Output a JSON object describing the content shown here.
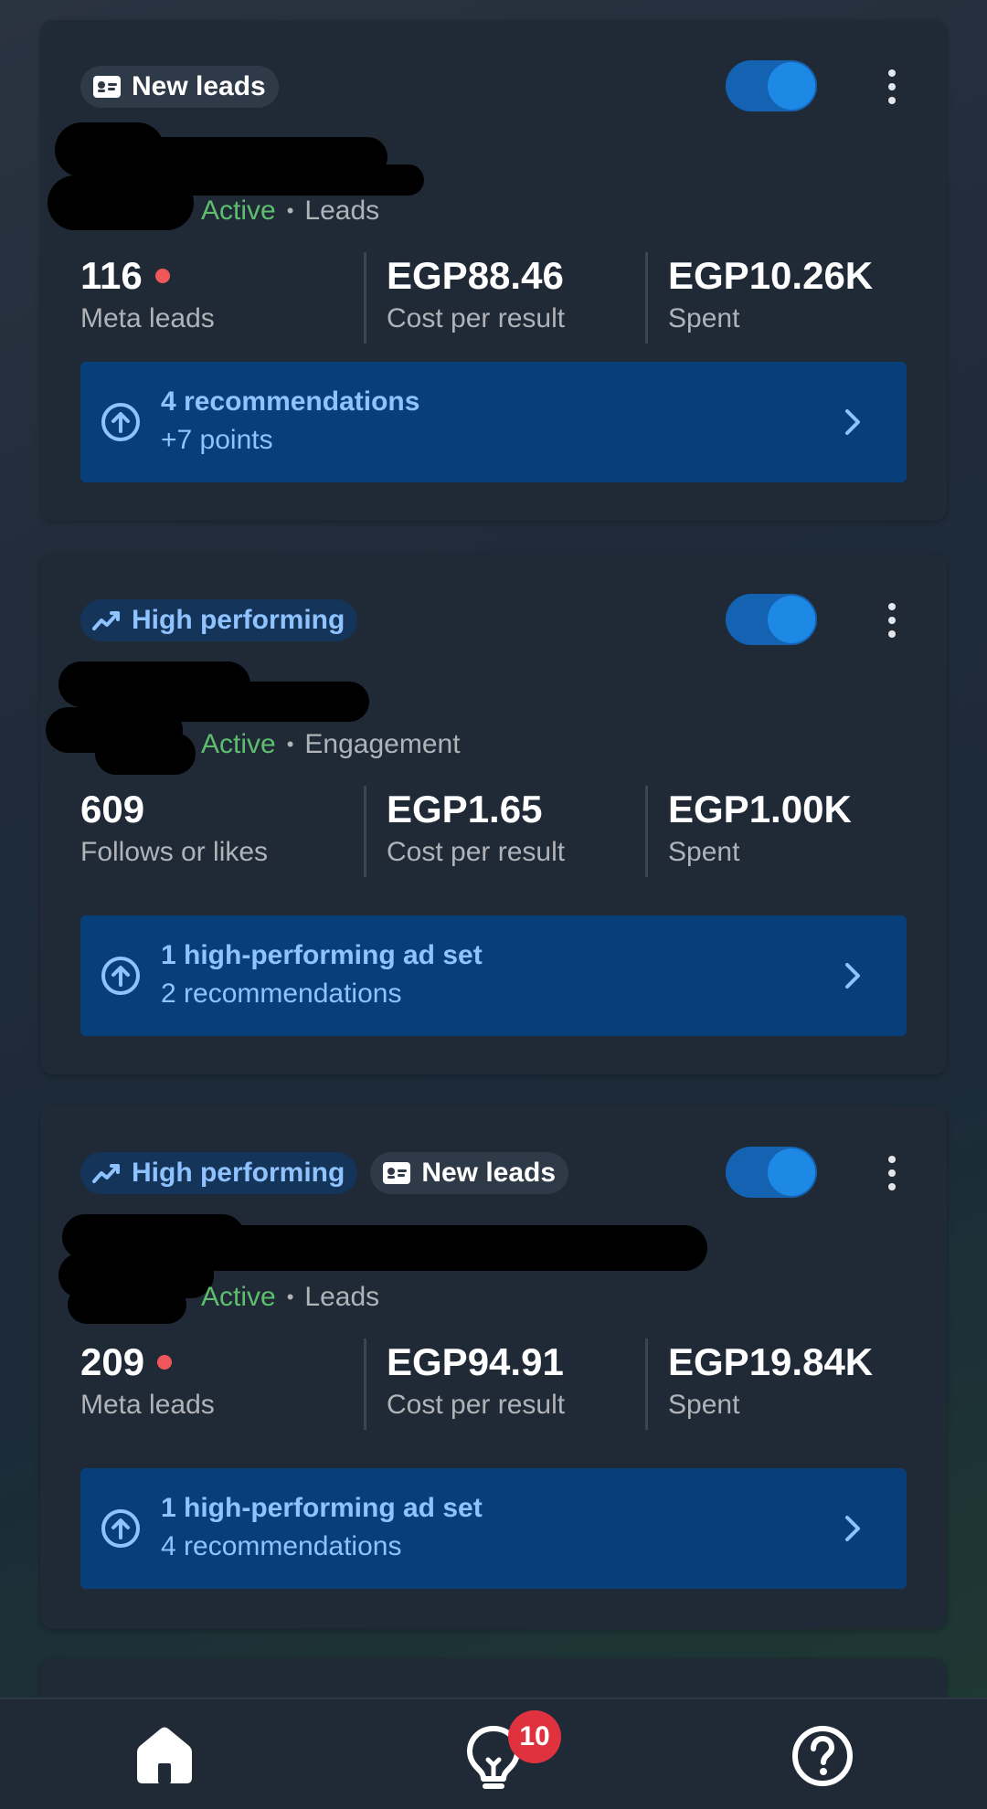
{
  "colors": {
    "accent_blue": "#1e88e5",
    "recommendation_bg": "#083f7a",
    "recommendation_text": "#8ec3ff",
    "active_green": "#5fbe6e",
    "alert_red": "#f0575b",
    "badge_red": "#e0323e"
  },
  "tags": {
    "new_leads": "New leads",
    "high_performing": "High performing"
  },
  "campaigns": [
    {
      "status": "Active",
      "objective": "Leads",
      "metrics": [
        {
          "value": "116",
          "label": "Meta leads",
          "alert_dot": true
        },
        {
          "value": "EGP88.46",
          "label": "Cost per result"
        },
        {
          "value": "EGP10.26K",
          "label": "Spent"
        }
      ],
      "recommendation": {
        "line1": "4 recommendations",
        "line2": "+7 points"
      },
      "toggle_on": true
    },
    {
      "status": "Active",
      "objective": "Engagement",
      "metrics": [
        {
          "value": "609",
          "label": "Follows or likes"
        },
        {
          "value": "EGP1.65",
          "label": "Cost per result"
        },
        {
          "value": "EGP1.00K",
          "label": "Spent"
        }
      ],
      "recommendation": {
        "line1": "1 high-performing ad set",
        "line2": "2 recommendations"
      },
      "toggle_on": true
    },
    {
      "status": "Active",
      "objective": "Leads",
      "metrics": [
        {
          "value": "209",
          "label": "Meta leads",
          "alert_dot": true
        },
        {
          "value": "EGP94.91",
          "label": "Cost per result"
        },
        {
          "value": "EGP19.84K",
          "label": "Spent"
        }
      ],
      "recommendation": {
        "line1": "1 high-performing ad set",
        "line2": "4 recommendations"
      },
      "toggle_on": true
    }
  ],
  "bottom_nav": {
    "items": [
      {
        "icon": "home-icon",
        "selected": true
      },
      {
        "icon": "lightbulb-icon",
        "badge": "10"
      },
      {
        "icon": "help-icon"
      }
    ]
  }
}
